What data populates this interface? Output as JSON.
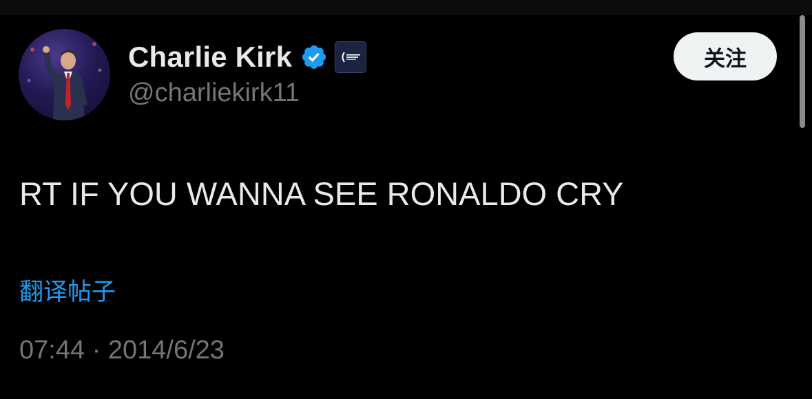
{
  "tweet": {
    "author": {
      "display_name": "Charlie Kirk",
      "handle": "@charliekirk11",
      "verified": true,
      "avatar_icon": "profile-photo",
      "org_badge_icon": "turning-point-usa-badge"
    },
    "follow_label": "关注",
    "text": "RT IF YOU WANNA SEE RONALDO CRY",
    "translate_label": "翻译帖子",
    "time": "07:44",
    "separator": "·",
    "date": "2014/6/23"
  },
  "colors": {
    "background": "#000000",
    "primary_text": "#e7e9ea",
    "secondary_text": "#71767b",
    "link": "#1d9bf0",
    "verified": "#1d9bf0",
    "button_bg": "#eff3f4"
  }
}
